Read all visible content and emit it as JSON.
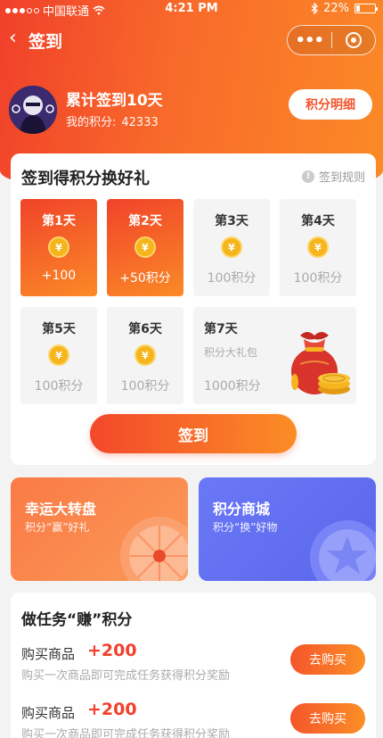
{
  "status_bar": {
    "carrier": "中国联通",
    "time": "4:21 PM",
    "battery": "22%",
    "battery_level": 0.22
  },
  "nav": {
    "back_icon": "‹",
    "title": "签到",
    "more_icon": "•••"
  },
  "user": {
    "title": "累计签到10天",
    "points_label": "我的积分:",
    "points_value": "42333",
    "detail_button": "积分明细"
  },
  "checkin": {
    "title": "签到得积分换好礼",
    "rules_label": "签到规则",
    "coin_symbol": "¥",
    "days": [
      {
        "label": "第1天",
        "amount": "+100",
        "done": true
      },
      {
        "label": "第2天",
        "amount": "+50积分",
        "done": true
      },
      {
        "label": "第3天",
        "amount": "100积分",
        "done": false
      },
      {
        "label": "第4天",
        "amount": "100积分",
        "done": false
      },
      {
        "label": "第5天",
        "amount": "100积分",
        "done": false
      },
      {
        "label": "第6天",
        "amount": "100积分",
        "done": false
      }
    ],
    "day7": {
      "label": "第7天",
      "subtitle": "积分大礼包",
      "amount": "1000积分"
    },
    "button": "签到"
  },
  "promos": {
    "wheel": {
      "title": "幸运大转盘",
      "subtitle": "积分“赢”好礼"
    },
    "mall": {
      "title": "积分商城",
      "subtitle": "积分“换”好物"
    }
  },
  "tasks": {
    "title": "做任务“赚”积分",
    "items": [
      {
        "name": "购买商品",
        "points": "+200",
        "desc": "购买一次商品即可完成任务获得积分奖励",
        "button": "去购买"
      },
      {
        "name": "购买商品",
        "points": "+200",
        "desc": "购买一次商品即可完成任务获得积分奖励",
        "button": "去购买"
      }
    ]
  },
  "colors": {
    "accent_start": "#f0402a",
    "accent_end": "#fb8a26",
    "points_red": "#f2402d",
    "mall_blue": "#5b66ea"
  }
}
